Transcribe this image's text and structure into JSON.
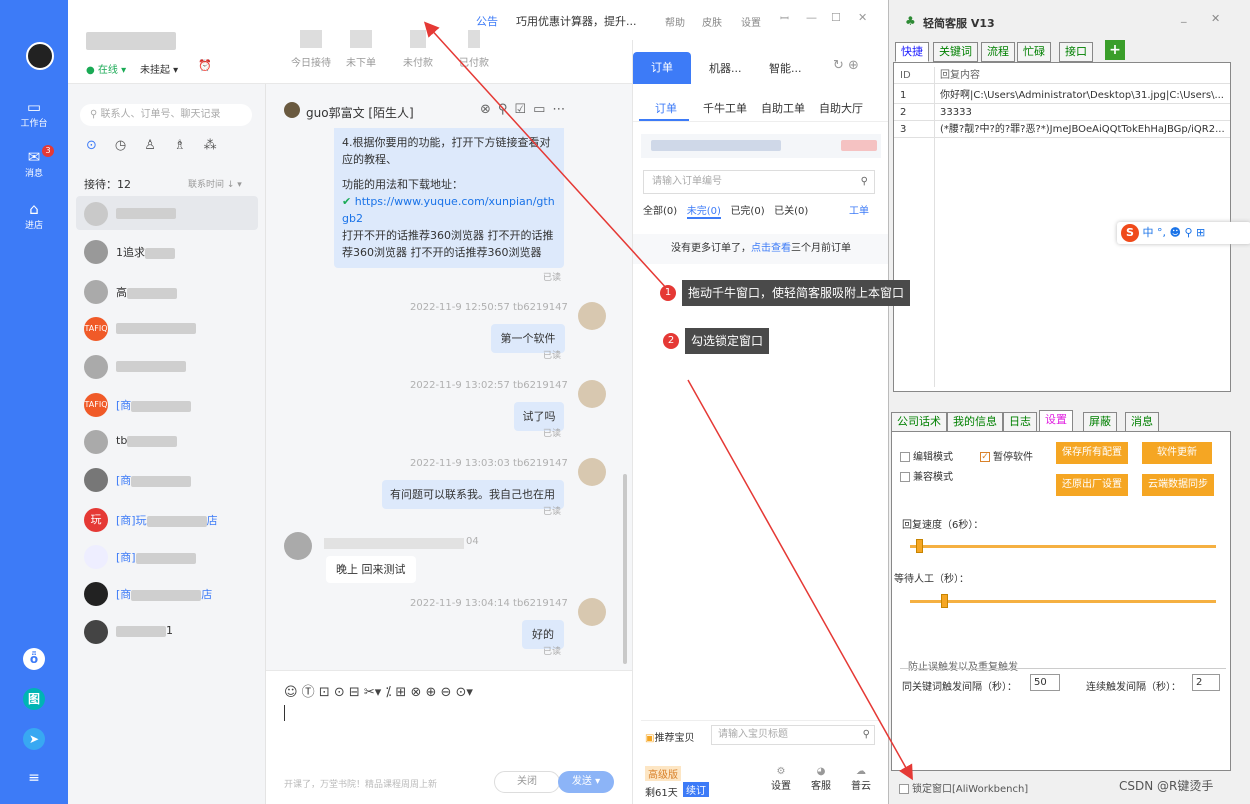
{
  "leftbar": {
    "items": [
      {
        "label": "工作台",
        "icon": "briefcase-icon",
        "glyph": "▭"
      },
      {
        "label": "消息",
        "icon": "message-icon",
        "glyph": "✉",
        "badge": "3"
      },
      {
        "label": "进店",
        "icon": "store-icon",
        "glyph": "⌂"
      }
    ],
    "bottom_icons": [
      {
        "glyph": "ȫ"
      },
      {
        "glyph": "图"
      },
      {
        "glyph": "➤"
      },
      {
        "glyph": "≡"
      }
    ]
  },
  "topbar": {
    "status_online": "● 在线 ▾",
    "status_hang": "未挂起 ▾",
    "stats": [
      "今日接待",
      "未下单",
      "未付款",
      "已付款"
    ],
    "notice_label": "公告",
    "notice_text": "巧用优惠计算器，提升...",
    "menu": [
      "帮助",
      "皮肤",
      "设置"
    ],
    "win_controls": [
      "ꟷ",
      "—",
      "☐",
      "✕"
    ]
  },
  "contacts": {
    "search_placeholder": "联系人、订单号、聊天记录",
    "reception": "接待：12",
    "sort": "联系时间 ↓ ▾",
    "items": [
      {
        "name": "",
        "avatar": ""
      },
      {
        "name": "1追求",
        "avatar": ""
      },
      {
        "name": "高",
        "avatar": ""
      },
      {
        "name": "",
        "avatar": "TAFIQ"
      },
      {
        "name": "",
        "avatar": ""
      },
      {
        "name": "[商",
        "avatar": "TAFIQ"
      },
      {
        "name": "tb",
        "avatar": ""
      },
      {
        "name": "[商",
        "avatar": ""
      },
      {
        "name": "[商]玩",
        "avatar": "玩"
      },
      {
        "name": "[商]",
        "avatar": ""
      },
      {
        "name": "[商",
        "avatar": ""
      },
      {
        "name": "1",
        "avatar": ""
      }
    ],
    "suffix_a": "店",
    "suffix_b": "店"
  },
  "chat": {
    "title": "guo郭富文 [陌生人]",
    "msg1_lines": [
      "4.根据你要用的功能，打开下方链接查看对",
      "应的教程、",
      "",
      "功能的用法和下载地址："
    ],
    "msg1_link": "https://www.yuque.com/xunpian/gthgb2",
    "msg1_tail": "打开不开的话推荐360浏览器 打不开的话推荐360浏览器 打不开的话推荐360浏览器",
    "read": "已读",
    "messages": [
      {
        "time": "2022-11-9 12:50:57  tb6219147",
        "text": "第一个软件"
      },
      {
        "time": "2022-11-9 13:02:57  tb6219147",
        "text": "试了吗"
      },
      {
        "time": "2022-11-9 13:03:03  tb6219147",
        "text": "有问题可以联系我。我自己也在用"
      }
    ],
    "incoming": "晚上 回来测试",
    "incoming_time": "04",
    "last": {
      "time": "2022-11-9 13:04:14  tb6219147",
      "text": "好的"
    },
    "toolbar": "☺ Ⓣ ⊡ ⊙ ⊟ ✂▾ ⁒ ⊞ ⊗ ⊕   ⊖ ⊙▾",
    "footer_ad": "开课了，万堂书院！精品课程周周上新",
    "close_btn": "关闭",
    "send_btn": "发送"
  },
  "orders": {
    "tabs": [
      "订单",
      "机器...",
      "智能..."
    ],
    "subtabs": [
      "订单",
      "千牛工单",
      "自助工单",
      "自助大厅"
    ],
    "search_placeholder": "请输入订单编号",
    "filters": [
      "全部(0)",
      "未完(0)",
      "已完(0)",
      "已关(0)"
    ],
    "worklink": "工单",
    "empty_text": "没有更多订单了，",
    "empty_link": "点击查看",
    "empty_tail": "三个月前订单",
    "recommend": "推荐宝贝",
    "recommend_placeholder": "请输入宝贝标题",
    "vip": "高级版",
    "days": "剩61天",
    "renew": "续订",
    "bottom": [
      "设置",
      "客服",
      "普云"
    ]
  },
  "callouts": [
    {
      "num": "1",
      "text": "拖动千牛窗口，使轻简客服吸附上本窗口"
    },
    {
      "num": "2",
      "text": "勾选锁定窗口"
    }
  ],
  "jj": {
    "title": "轻简客服 V13",
    "controls": [
      "_",
      "✕"
    ],
    "tabs": [
      "快捷",
      "关键词",
      "流程",
      "忙碌",
      "接口"
    ],
    "plus": "+",
    "headers": [
      "ID",
      "回复内容"
    ],
    "rows": [
      {
        "id": "1",
        "text": "你好啊|C:\\Users\\Administrator\\Desktop\\31.jpg|C:\\Users\\..."
      },
      {
        "id": "2",
        "text": "33333"
      },
      {
        "id": "3",
        "text": "(*腰?靓?中?的?罪?恶?*)JmeJBOeAiQQtTokEhHaJBGp/iQR2..."
      }
    ],
    "ime": "中 °, ☻ ⚲ ⊞",
    "tabs2": [
      "公司话术",
      "我的信息",
      "日志",
      "设置",
      "屏蔽",
      "消息"
    ],
    "cb_edit": "编辑模式",
    "cb_pause": "暂停软件",
    "cb_compat": "兼容模式",
    "btn_save": "保存所有配置",
    "btn_update": "软件更新",
    "btn_reset": "还原出厂设置",
    "btn_cloud": "云端数据同步",
    "reply_speed": "回复速度（6秒）：",
    "wait_human": "等待人工（秒）：",
    "anti_title": "防止误触发以及重复触发",
    "kw_interval": "同关键词触发间隔（秒）：",
    "kw_value": "50",
    "cont_interval": "连续触发间隔（秒）：",
    "cont_value": "2",
    "lock": "锁定窗口[AliWorkbench]",
    "reply_speed_level": 0.02,
    "wait_human_level": 0.1
  },
  "watermark": "CSDN @R键烫手"
}
